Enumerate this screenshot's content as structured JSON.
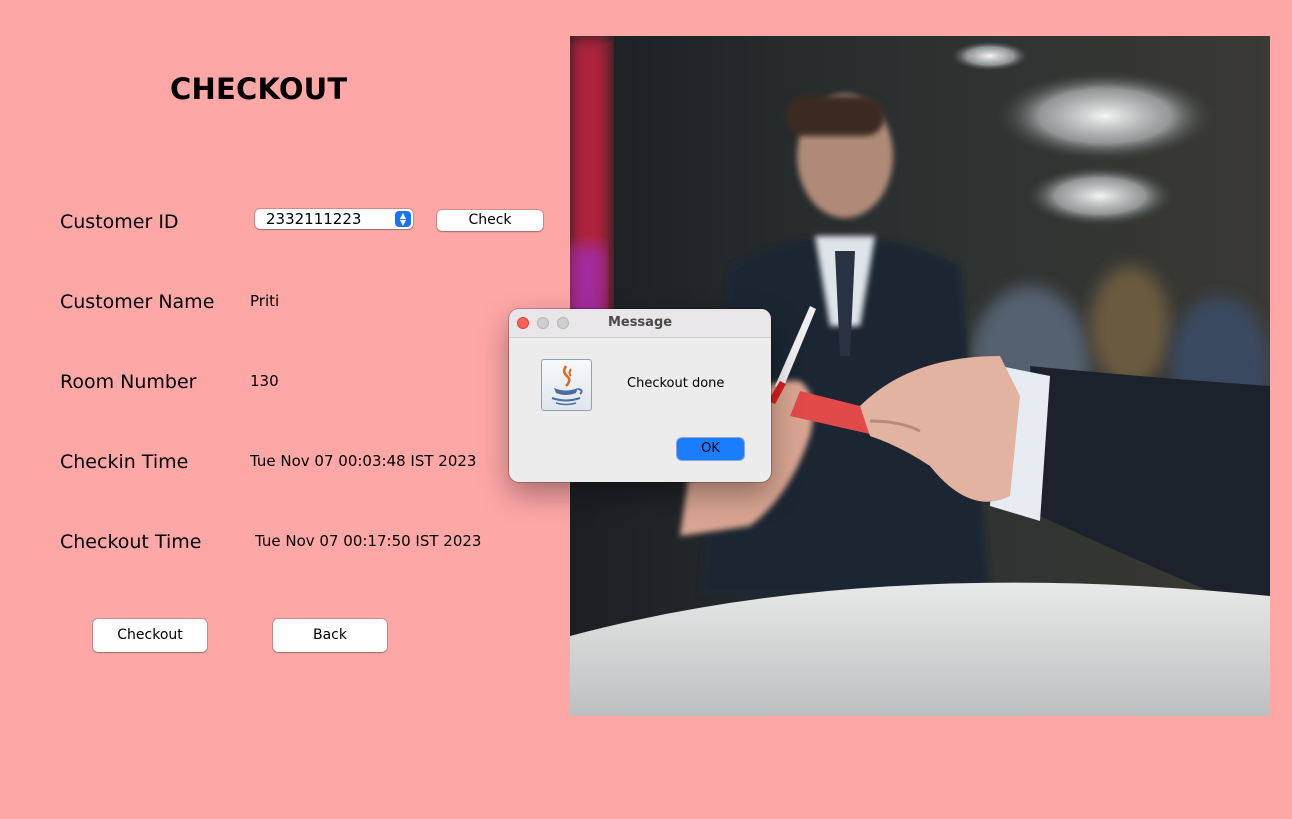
{
  "page": {
    "title": "CHECKOUT"
  },
  "form": {
    "customer_id_label": "Customer ID",
    "customer_id_value": "2332111223",
    "check_label": "Check",
    "customer_name_label": "Customer Name",
    "customer_name_value": "Priti",
    "room_number_label": "Room Number",
    "room_number_value": "130",
    "checkin_label": "Checkin Time",
    "checkin_value": "Tue Nov 07 00:03:48 IST 2023",
    "checkout_label": "Checkout Time",
    "checkout_value": "Tue Nov 07 00:17:50 IST 2023"
  },
  "actions": {
    "checkout_label": "Checkout",
    "back_label": "Back"
  },
  "dialog": {
    "title": "Message",
    "message": "Checkout done",
    "ok_label": "OK",
    "icon": "java-icon"
  },
  "colors": {
    "background": "#fea7a7",
    "accent": "#1a7cfe"
  }
}
